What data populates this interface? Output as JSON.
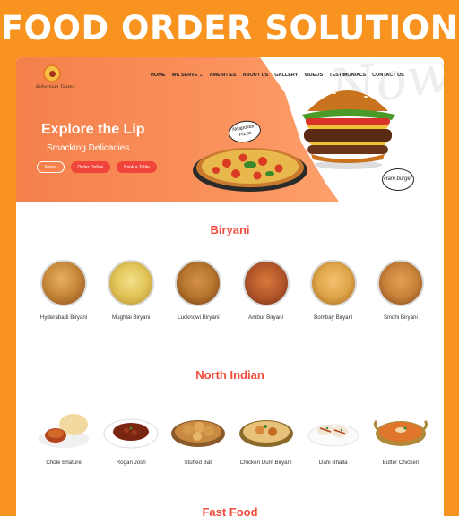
{
  "banner": {
    "title": "FOOD ORDER SOLUTION"
  },
  "colors": {
    "brand_orange": "#f7931e",
    "accent_red": "#f24c3d",
    "hero_orange": "#f4804a"
  },
  "logo": {
    "text": "Bohemian Tastes"
  },
  "nav": {
    "items": [
      {
        "label": "HOME"
      },
      {
        "label": "WE SERVE ⌄"
      },
      {
        "label": "AMENITIES"
      },
      {
        "label": "ABOUT US"
      },
      {
        "label": "GALLERY"
      },
      {
        "label": "VIDEOS"
      },
      {
        "label": "TESTIMONIALS"
      },
      {
        "label": "CONTACT US"
      }
    ]
  },
  "hero": {
    "title": "Explore the Lip",
    "subtitle": "Smacking Delicacies",
    "buttons": {
      "menu": "Menu",
      "order": "Order Online",
      "book": "Book a Table"
    },
    "bubble_pizza": "Neapolitan Pizza",
    "bubble_burger": "Ham burger",
    "bg_text": "Now Good"
  },
  "sections": [
    {
      "title": "Biryani",
      "items": [
        {
          "label": "Hyderabadi Biryani",
          "color": "#c98a3c"
        },
        {
          "label": "Mughlai Biryani",
          "color": "#e2c458"
        },
        {
          "label": "Lucknowi Biryani",
          "color": "#b7752e"
        },
        {
          "label": "Ambur Biryani",
          "color": "#b0552a"
        },
        {
          "label": "Bombay Biryani",
          "color": "#e0a64a"
        },
        {
          "label": "Sindhi Biryani",
          "color": "#c8823a"
        }
      ]
    },
    {
      "title": "North Indian",
      "items": [
        {
          "label": "Chole Bhature",
          "color": "#b3441c"
        },
        {
          "label": "Rogan Josh",
          "color": "#7a2412"
        },
        {
          "label": "Stuffed Bati",
          "color": "#d49a4a"
        },
        {
          "label": "Chicken Dum Biryani",
          "color": "#d8883a"
        },
        {
          "label": "Dahi Bhalla",
          "color": "#f2e6d4"
        },
        {
          "label": "Butter Chicken",
          "color": "#e0762c"
        }
      ]
    },
    {
      "title": "Fast Food"
    }
  ]
}
